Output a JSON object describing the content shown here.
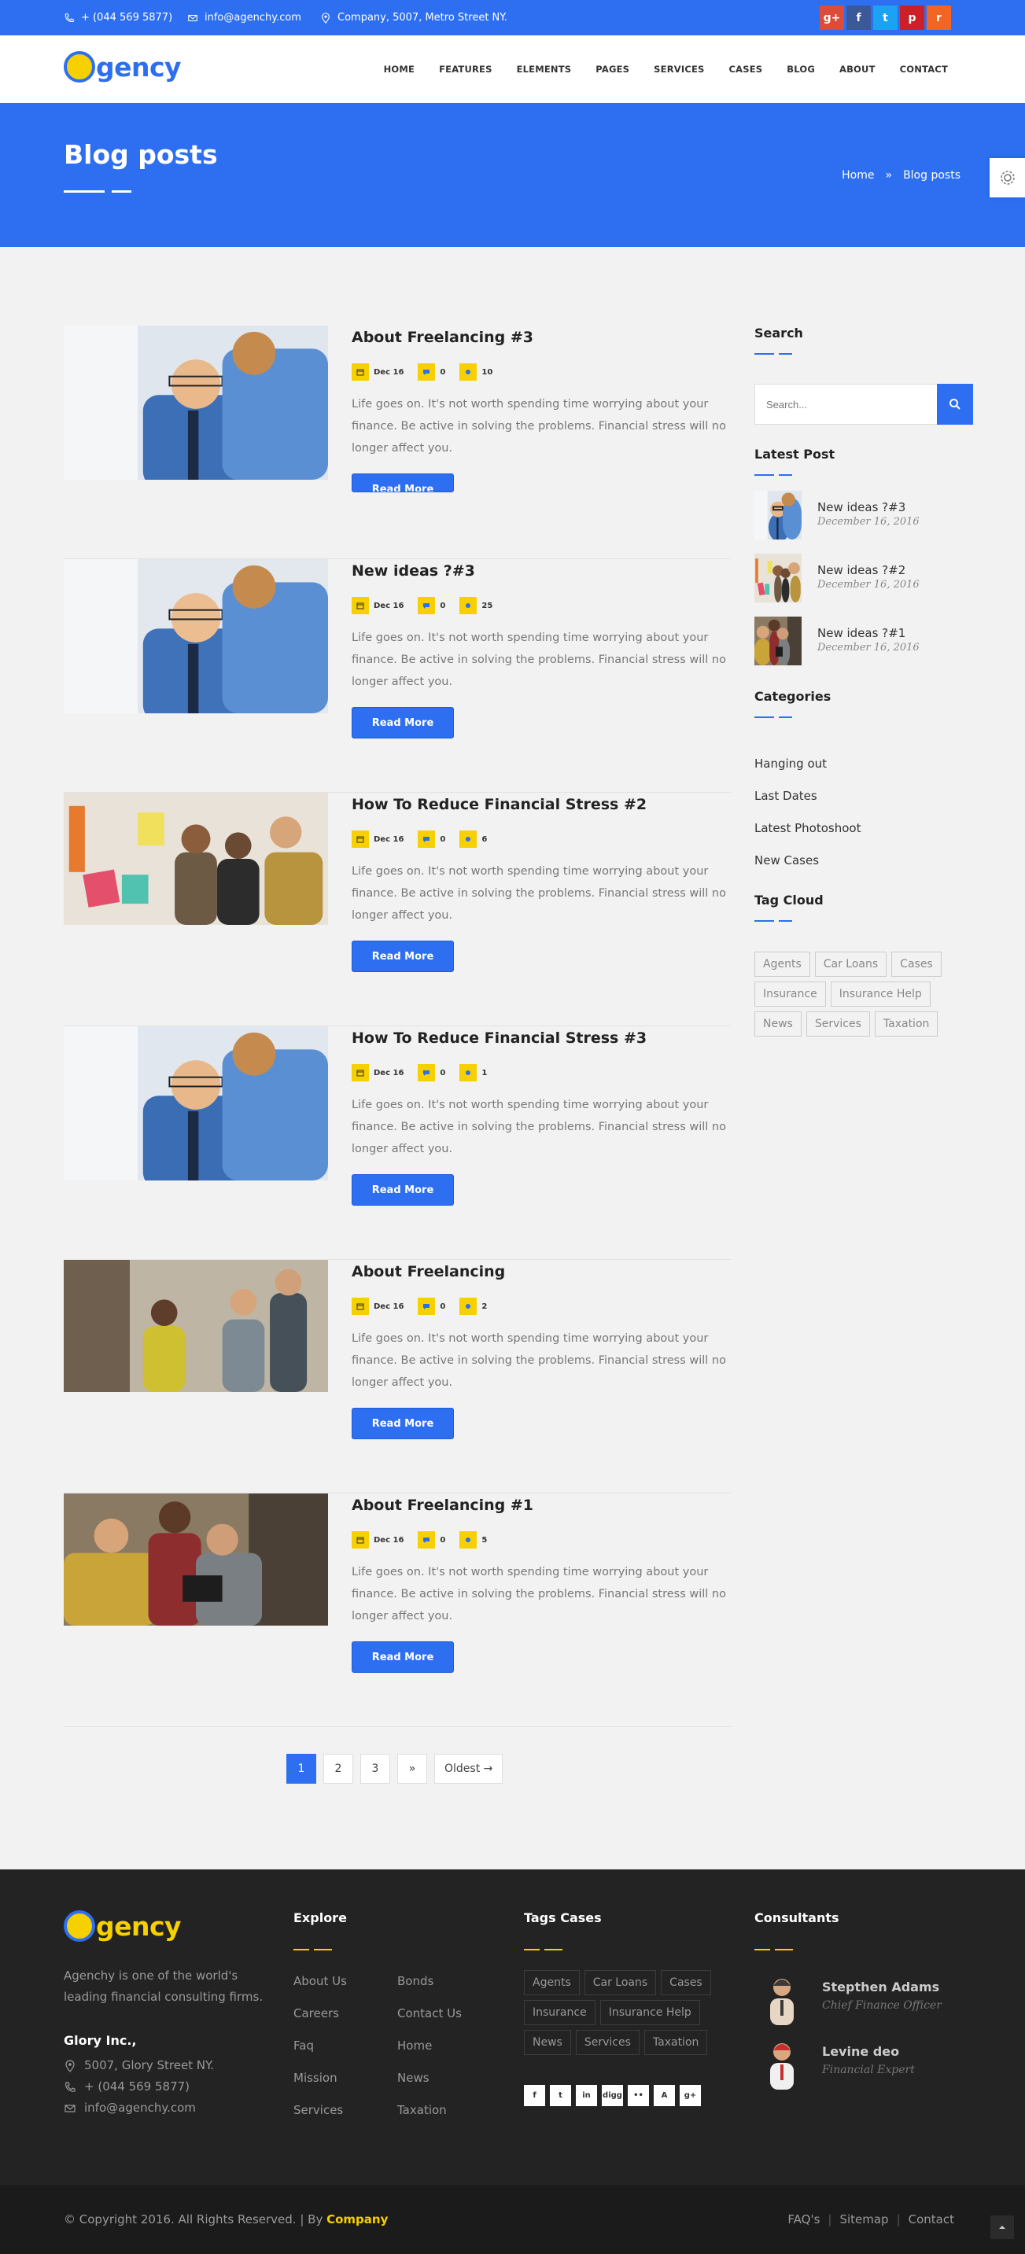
{
  "topbar": {
    "phone": "+ (044 569 5877)",
    "email": "info@agenchy.com",
    "address": "Company, 5007, Metro Street NY.",
    "social": [
      {
        "icon": "google-plus-icon",
        "glyph": "g+",
        "color": "#dd4b39"
      },
      {
        "icon": "facebook-icon",
        "glyph": "f",
        "color": "#3b5998"
      },
      {
        "icon": "twitter-icon",
        "glyph": "t",
        "color": "#1da1f2"
      },
      {
        "icon": "pinterest-icon",
        "glyph": "p",
        "color": "#cb2027"
      },
      {
        "icon": "rss-icon",
        "glyph": "r",
        "color": "#f26522"
      }
    ]
  },
  "header": {
    "logo": "gency",
    "nav": [
      "HOME",
      "FEATURES",
      "ELEMENTS",
      "PAGES",
      "SERVICES",
      "CASES",
      "BLOG",
      "ABOUT",
      "CONTACT"
    ]
  },
  "banner": {
    "title": "Blog posts",
    "breadcrumb_home": "Home",
    "breadcrumb_sep": "»",
    "breadcrumb_current": "Blog posts"
  },
  "posts": [
    {
      "title": "About Freelancing #3",
      "date": "Dec 16",
      "comments": "0",
      "likes": "10",
      "text": "Life goes on. It's not worth spending time worrying about your finance. Be active in solving the problems. Financial stress will no longer affect you.",
      "button": "Read More"
    },
    {
      "title": "New ideas ?#3",
      "date": "Dec 16",
      "comments": "0",
      "likes": "25",
      "text": "Life goes on. It's not worth spending time worrying about your finance. Be active in solving the problems. Financial stress will no longer affect you.",
      "button": "Read More"
    },
    {
      "title": "How To Reduce Financial Stress #2",
      "date": "Dec 16",
      "comments": "0",
      "likes": "6",
      "text": "Life goes on. It's not worth spending time worrying about your finance. Be active in solving the problems. Financial stress will no longer affect you.",
      "button": "Read More"
    },
    {
      "title": "How To Reduce Financial Stress #3",
      "date": "Dec 16",
      "comments": "0",
      "likes": "1",
      "text": "Life goes on. It's not worth spending time worrying about your finance. Be active in solving the problems. Financial stress will no longer affect you.",
      "button": "Read More"
    },
    {
      "title": "About Freelancing",
      "date": "Dec 16",
      "comments": "0",
      "likes": "2",
      "text": "Life goes on. It's not worth spending time worrying about your finance. Be active in solving the problems. Financial stress will no longer affect you.",
      "button": "Read More"
    },
    {
      "title": "About Freelancing #1",
      "date": "Dec 16",
      "comments": "0",
      "likes": "5",
      "text": "Life goes on. It's not worth spending time worrying about your finance. Be active in solving the problems. Financial stress will no longer affect you.",
      "button": "Read More"
    }
  ],
  "pagination": [
    "1",
    "2",
    "3",
    "»",
    "Oldest →"
  ],
  "sidebar": {
    "search_title": "Search",
    "search_placeholder": "Search...",
    "latest_title": "Latest Post",
    "latest": [
      {
        "title": "New ideas ?#3",
        "date": "December 16, 2016"
      },
      {
        "title": "New ideas ?#2",
        "date": "December 16, 2016"
      },
      {
        "title": "New ideas ?#1",
        "date": "December 16, 2016"
      }
    ],
    "categories_title": "Categories",
    "categories": [
      "Hanging out",
      "Last Dates",
      "Latest Photoshoot",
      "New Cases"
    ],
    "tags_title": "Tag Cloud",
    "tags": [
      "Agents",
      "Car Loans",
      "Cases",
      "Insurance",
      "Insurance Help",
      "News",
      "Services",
      "Taxation"
    ]
  },
  "footer": {
    "logo": "gency",
    "about": "Agenchy is one of the world's leading financial consulting firms.",
    "company": "Glory Inc.,",
    "address": "5007, Glory Street NY.",
    "phone": "+ (044 569 5877)",
    "email": "info@agenchy.com",
    "explore_title": "Explore",
    "explore_col1": [
      "About Us",
      "Careers",
      "Faq",
      "Mission",
      "Services"
    ],
    "explore_col2": [
      "Bonds",
      "Contact Us",
      "Home",
      "News",
      "Taxation"
    ],
    "tags_title": "Tags Cases",
    "tags": [
      "Agents",
      "Car Loans",
      "Cases",
      "Insurance",
      "Insurance Help",
      "News",
      "Services",
      "Taxation"
    ],
    "social": [
      "f",
      "t",
      "in",
      "digg",
      "••",
      "A",
      "g+"
    ],
    "consultants_title": "Consultants",
    "consultants": [
      {
        "name": "Stepthen Adams",
        "role": "Chief Finance Officer"
      },
      {
        "name": "Levine deo",
        "role": "Financial Expert"
      }
    ]
  },
  "bottom": {
    "copyright": "© Copyright 2016. All Rights Reserved. | By ",
    "company": "Company",
    "links": [
      "FAQ's",
      "Sitemap",
      "Contact"
    ]
  }
}
